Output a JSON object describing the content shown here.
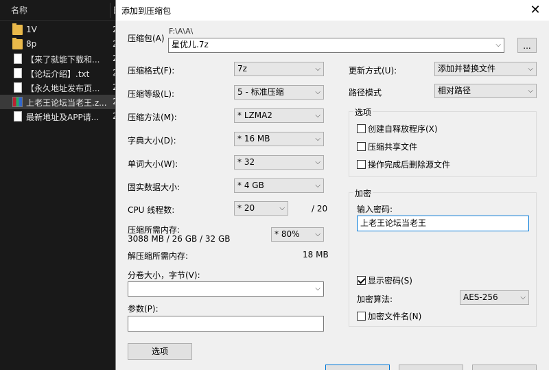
{
  "explorer": {
    "header_name": "名称",
    "header_date_initial": "日",
    "items": [
      {
        "name": "1V",
        "date": "2",
        "icon": "folder-icon"
      },
      {
        "name": "8p",
        "date": "2",
        "icon": "folder-icon"
      },
      {
        "name": "【来了就能下载和...",
        "date": "2",
        "icon": "document-icon"
      },
      {
        "name": "【论坛介绍】.txt",
        "date": "2",
        "icon": "text-file-icon"
      },
      {
        "name": "【永久地址发布页...",
        "date": "2",
        "icon": "document-icon"
      },
      {
        "name": "上老王论坛当老王.z...",
        "date": "2",
        "icon": "archive-icon"
      },
      {
        "name": "最新地址及APP请...",
        "date": "2",
        "icon": "document-icon"
      }
    ]
  },
  "dialog": {
    "title": "添加到压缩包",
    "archive_label": "压缩包(A)",
    "archive_path": "F:\\A\\A\\",
    "archive_name": "星优儿.7z",
    "browse_label": "...",
    "format_label": "压缩格式(F):",
    "format_value": "7z",
    "level_label": "压缩等级(L):",
    "level_value": "5 - 标准压缩",
    "method_label": "压缩方法(M):",
    "method_value": "* LZMA2",
    "dict_label": "字典大小(D):",
    "dict_value": "* 16 MB",
    "word_label": "单词大小(W):",
    "word_value": "* 32",
    "solid_label": "固实数据大小:",
    "solid_value": "* 4 GB",
    "cpu_label": "CPU 线程数:",
    "cpu_value": "* 20",
    "cpu_total": "/ 20",
    "mem_label": "压缩所需内存:",
    "mem_value": "3088 MB / 26 GB / 32 GB",
    "mem_percent": "* 80%",
    "decomp_label": "解压缩所需内存:",
    "decomp_value": "18 MB",
    "split_label": "分卷大小，字节(V):",
    "split_value": "",
    "params_label": "参数(P):",
    "params_value": "",
    "options_button": "选项",
    "update_label": "更新方式(U):",
    "update_value": "添加并替换文件",
    "path_label": "路径模式",
    "path_value": "相对路径",
    "options_group": "选项",
    "opt_sfx": "创建自释放程序(X)",
    "opt_shared": "压缩共享文件",
    "opt_delete": "操作完成后删除源文件",
    "encrypt_group": "加密",
    "password_label": "输入密码:",
    "password_value": "上老王论坛当老王",
    "show_password": "显示密码(S)",
    "enc_method_label": "加密算法:",
    "enc_method_value": "AES-256",
    "enc_names": "加密文件名(N)"
  }
}
